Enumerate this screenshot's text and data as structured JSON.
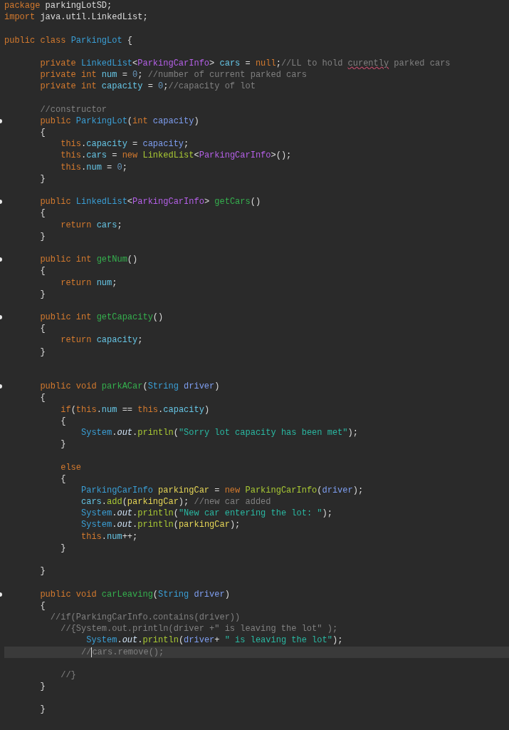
{
  "editor": {
    "lines": [
      {
        "kind": "code",
        "tokens": [
          {
            "kind": "keyword",
            "text": "package"
          },
          {
            "kind": "plain",
            "text": " parkingLotSD;"
          }
        ]
      },
      {
        "kind": "code",
        "tokens": [
          {
            "kind": "keyword",
            "text": "import"
          },
          {
            "kind": "plain",
            "text": " java.util.LinkedList;"
          }
        ]
      },
      {
        "kind": "blank"
      },
      {
        "kind": "code",
        "tokens": [
          {
            "kind": "keyword",
            "text": "public class "
          },
          {
            "kind": "type",
            "text": "ParkingLot"
          },
          {
            "kind": "plain",
            "text": " {"
          }
        ]
      },
      {
        "kind": "blank"
      },
      {
        "kind": "code",
        "tokens": [
          {
            "kind": "keyword",
            "text": "       private "
          },
          {
            "kind": "type",
            "text": "LinkedList"
          },
          {
            "kind": "plain",
            "text": "<"
          },
          {
            "kind": "generic",
            "text": "ParkingCarInfo"
          },
          {
            "kind": "plain",
            "text": "> "
          },
          {
            "kind": "field",
            "text": "cars"
          },
          {
            "kind": "plain",
            "text": " = "
          },
          {
            "kind": "keyword",
            "text": "null"
          },
          {
            "kind": "plain",
            "text": ";"
          },
          {
            "kind": "comment",
            "text": "//LL to hold "
          },
          {
            "kind": "misspelled",
            "text": "curently"
          },
          {
            "kind": "comment",
            "text": " parked cars"
          }
        ]
      },
      {
        "kind": "code",
        "tokens": [
          {
            "kind": "keyword",
            "text": "       private int "
          },
          {
            "kind": "field",
            "text": "num"
          },
          {
            "kind": "plain",
            "text": " = "
          },
          {
            "kind": "number",
            "text": "0"
          },
          {
            "kind": "plain",
            "text": ";"
          },
          {
            "kind": "comment",
            "text": " //number of current parked cars"
          }
        ]
      },
      {
        "kind": "code",
        "tokens": [
          {
            "kind": "keyword",
            "text": "       private int "
          },
          {
            "kind": "field",
            "text": "capacity"
          },
          {
            "kind": "plain",
            "text": " = "
          },
          {
            "kind": "number",
            "text": "0"
          },
          {
            "kind": "plain",
            "text": ";"
          },
          {
            "kind": "comment",
            "text": "//capacity of lot"
          }
        ]
      },
      {
        "kind": "blank"
      },
      {
        "kind": "code",
        "tokens": [
          {
            "kind": "comment",
            "text": "       //constructor"
          }
        ]
      },
      {
        "kind": "code",
        "marker": true,
        "tokens": [
          {
            "kind": "keyword",
            "text": "       public "
          },
          {
            "kind": "type",
            "text": "ParkingLot"
          },
          {
            "kind": "plain",
            "text": "("
          },
          {
            "kind": "keyword",
            "text": "int "
          },
          {
            "kind": "param",
            "text": "capacity"
          },
          {
            "kind": "plain",
            "text": ")"
          }
        ]
      },
      {
        "kind": "code",
        "tokens": [
          {
            "kind": "plain",
            "text": "       {"
          }
        ]
      },
      {
        "kind": "code",
        "tokens": [
          {
            "kind": "keyword",
            "text": "           this"
          },
          {
            "kind": "plain",
            "text": "."
          },
          {
            "kind": "field",
            "text": "capacity"
          },
          {
            "kind": "plain",
            "text": " = "
          },
          {
            "kind": "param",
            "text": "capacity"
          },
          {
            "kind": "plain",
            "text": ";"
          }
        ]
      },
      {
        "kind": "code",
        "tokens": [
          {
            "kind": "keyword",
            "text": "           this"
          },
          {
            "kind": "plain",
            "text": "."
          },
          {
            "kind": "field",
            "text": "cars"
          },
          {
            "kind": "plain",
            "text": " = "
          },
          {
            "kind": "keyword",
            "text": "new "
          },
          {
            "kind": "call",
            "text": "LinkedList"
          },
          {
            "kind": "plain",
            "text": "<"
          },
          {
            "kind": "generic",
            "text": "ParkingCarInfo"
          },
          {
            "kind": "plain",
            "text": ">();"
          }
        ]
      },
      {
        "kind": "code",
        "tokens": [
          {
            "kind": "keyword",
            "text": "           this"
          },
          {
            "kind": "plain",
            "text": "."
          },
          {
            "kind": "field",
            "text": "num"
          },
          {
            "kind": "plain",
            "text": " = "
          },
          {
            "kind": "number",
            "text": "0"
          },
          {
            "kind": "plain",
            "text": ";"
          }
        ]
      },
      {
        "kind": "code",
        "tokens": [
          {
            "kind": "plain",
            "text": "       }"
          }
        ]
      },
      {
        "kind": "blank"
      },
      {
        "kind": "code",
        "marker": true,
        "tokens": [
          {
            "kind": "keyword",
            "text": "       public "
          },
          {
            "kind": "type",
            "text": "LinkedList"
          },
          {
            "kind": "plain",
            "text": "<"
          },
          {
            "kind": "generic",
            "text": "ParkingCarInfo"
          },
          {
            "kind": "plain",
            "text": "> "
          },
          {
            "kind": "method",
            "text": "getCars"
          },
          {
            "kind": "plain",
            "text": "()"
          }
        ]
      },
      {
        "kind": "code",
        "tokens": [
          {
            "kind": "plain",
            "text": "       {"
          }
        ]
      },
      {
        "kind": "code",
        "tokens": [
          {
            "kind": "keyword",
            "text": "           return "
          },
          {
            "kind": "field",
            "text": "cars"
          },
          {
            "kind": "plain",
            "text": ";"
          }
        ]
      },
      {
        "kind": "code",
        "tokens": [
          {
            "kind": "plain",
            "text": "       }"
          }
        ]
      },
      {
        "kind": "blank"
      },
      {
        "kind": "code",
        "marker": true,
        "tokens": [
          {
            "kind": "keyword",
            "text": "       public int "
          },
          {
            "kind": "method",
            "text": "getNum"
          },
          {
            "kind": "plain",
            "text": "()"
          }
        ]
      },
      {
        "kind": "code",
        "tokens": [
          {
            "kind": "plain",
            "text": "       {"
          }
        ]
      },
      {
        "kind": "code",
        "tokens": [
          {
            "kind": "keyword",
            "text": "           return "
          },
          {
            "kind": "field",
            "text": "num"
          },
          {
            "kind": "plain",
            "text": ";"
          }
        ]
      },
      {
        "kind": "code",
        "tokens": [
          {
            "kind": "plain",
            "text": "       }"
          }
        ]
      },
      {
        "kind": "blank"
      },
      {
        "kind": "code",
        "marker": true,
        "tokens": [
          {
            "kind": "keyword",
            "text": "       public int "
          },
          {
            "kind": "method",
            "text": "getCapacity"
          },
          {
            "kind": "plain",
            "text": "()"
          }
        ]
      },
      {
        "kind": "code",
        "tokens": [
          {
            "kind": "plain",
            "text": "       {"
          }
        ]
      },
      {
        "kind": "code",
        "tokens": [
          {
            "kind": "keyword",
            "text": "           return "
          },
          {
            "kind": "field",
            "text": "capacity"
          },
          {
            "kind": "plain",
            "text": ";"
          }
        ]
      },
      {
        "kind": "code",
        "tokens": [
          {
            "kind": "plain",
            "text": "       }"
          }
        ]
      },
      {
        "kind": "blank"
      },
      {
        "kind": "blank"
      },
      {
        "kind": "code",
        "marker": true,
        "tokens": [
          {
            "kind": "keyword",
            "text": "       public void "
          },
          {
            "kind": "method",
            "text": "parkACar"
          },
          {
            "kind": "plain",
            "text": "("
          },
          {
            "kind": "type",
            "text": "String "
          },
          {
            "kind": "param",
            "text": "driver"
          },
          {
            "kind": "plain",
            "text": ")"
          }
        ]
      },
      {
        "kind": "code",
        "tokens": [
          {
            "kind": "plain",
            "text": "       {"
          }
        ]
      },
      {
        "kind": "code",
        "tokens": [
          {
            "kind": "keyword",
            "text": "           if"
          },
          {
            "kind": "plain",
            "text": "("
          },
          {
            "kind": "keyword",
            "text": "this"
          },
          {
            "kind": "plain",
            "text": "."
          },
          {
            "kind": "field",
            "text": "num"
          },
          {
            "kind": "plain",
            "text": " == "
          },
          {
            "kind": "keyword",
            "text": "this"
          },
          {
            "kind": "plain",
            "text": "."
          },
          {
            "kind": "field",
            "text": "capacity"
          },
          {
            "kind": "plain",
            "text": ")"
          }
        ]
      },
      {
        "kind": "code",
        "tokens": [
          {
            "kind": "plain",
            "text": "           {"
          }
        ]
      },
      {
        "kind": "code",
        "tokens": [
          {
            "kind": "type",
            "text": "               System"
          },
          {
            "kind": "plain",
            "text": "."
          },
          {
            "kind": "static",
            "text": "out"
          },
          {
            "kind": "plain",
            "text": "."
          },
          {
            "kind": "call",
            "text": "println"
          },
          {
            "kind": "plain",
            "text": "("
          },
          {
            "kind": "string",
            "text": "\"Sorry lot capacity has been met\""
          },
          {
            "kind": "plain",
            "text": ");"
          }
        ]
      },
      {
        "kind": "code",
        "tokens": [
          {
            "kind": "plain",
            "text": "           }"
          }
        ]
      },
      {
        "kind": "blank"
      },
      {
        "kind": "code",
        "tokens": [
          {
            "kind": "keyword",
            "text": "           else"
          }
        ]
      },
      {
        "kind": "code",
        "tokens": [
          {
            "kind": "plain",
            "text": "           {"
          }
        ]
      },
      {
        "kind": "code",
        "tokens": [
          {
            "kind": "type",
            "text": "               ParkingCarInfo "
          },
          {
            "kind": "local",
            "text": "parkingCar"
          },
          {
            "kind": "plain",
            "text": " = "
          },
          {
            "kind": "keyword",
            "text": "new "
          },
          {
            "kind": "call",
            "text": "ParkingCarInfo"
          },
          {
            "kind": "plain",
            "text": "("
          },
          {
            "kind": "param",
            "text": "driver"
          },
          {
            "kind": "plain",
            "text": ");"
          }
        ]
      },
      {
        "kind": "code",
        "tokens": [
          {
            "kind": "field",
            "text": "               cars"
          },
          {
            "kind": "plain",
            "text": "."
          },
          {
            "kind": "call",
            "text": "add"
          },
          {
            "kind": "plain",
            "text": "("
          },
          {
            "kind": "local",
            "text": "parkingCar"
          },
          {
            "kind": "plain",
            "text": ");"
          },
          {
            "kind": "comment",
            "text": " //new car added"
          }
        ]
      },
      {
        "kind": "code",
        "tokens": [
          {
            "kind": "type",
            "text": "               System"
          },
          {
            "kind": "plain",
            "text": "."
          },
          {
            "kind": "static",
            "text": "out"
          },
          {
            "kind": "plain",
            "text": "."
          },
          {
            "kind": "call",
            "text": "println"
          },
          {
            "kind": "plain",
            "text": "("
          },
          {
            "kind": "string",
            "text": "\"New car entering the lot: \""
          },
          {
            "kind": "plain",
            "text": ");"
          }
        ]
      },
      {
        "kind": "code",
        "tokens": [
          {
            "kind": "type",
            "text": "               System"
          },
          {
            "kind": "plain",
            "text": "."
          },
          {
            "kind": "static",
            "text": "out"
          },
          {
            "kind": "plain",
            "text": "."
          },
          {
            "kind": "call",
            "text": "println"
          },
          {
            "kind": "plain",
            "text": "("
          },
          {
            "kind": "local",
            "text": "parkingCar"
          },
          {
            "kind": "plain",
            "text": ");"
          }
        ]
      },
      {
        "kind": "code",
        "tokens": [
          {
            "kind": "keyword",
            "text": "               this"
          },
          {
            "kind": "plain",
            "text": "."
          },
          {
            "kind": "field",
            "text": "num"
          },
          {
            "kind": "plain",
            "text": "++;"
          }
        ]
      },
      {
        "kind": "code",
        "tokens": [
          {
            "kind": "plain",
            "text": "           }"
          }
        ]
      },
      {
        "kind": "blank"
      },
      {
        "kind": "code",
        "tokens": [
          {
            "kind": "plain",
            "text": "       }"
          }
        ]
      },
      {
        "kind": "blank"
      },
      {
        "kind": "code",
        "marker": true,
        "tokens": [
          {
            "kind": "keyword",
            "text": "       public void "
          },
          {
            "kind": "method",
            "text": "carLeaving"
          },
          {
            "kind": "plain",
            "text": "("
          },
          {
            "kind": "type",
            "text": "String "
          },
          {
            "kind": "param",
            "text": "driver"
          },
          {
            "kind": "plain",
            "text": ")"
          }
        ]
      },
      {
        "kind": "code",
        "tokens": [
          {
            "kind": "plain",
            "text": "       {"
          }
        ]
      },
      {
        "kind": "code",
        "tokens": [
          {
            "kind": "comment",
            "text": "         //if(ParkingCarInfo.contains(driver))"
          }
        ]
      },
      {
        "kind": "code",
        "tokens": [
          {
            "kind": "comment",
            "text": "           //{System.out.println(driver +\" is leaving the lot\" );"
          }
        ]
      },
      {
        "kind": "code",
        "tokens": [
          {
            "kind": "type",
            "text": "                System"
          },
          {
            "kind": "plain",
            "text": "."
          },
          {
            "kind": "static",
            "text": "out"
          },
          {
            "kind": "plain",
            "text": "."
          },
          {
            "kind": "call",
            "text": "println"
          },
          {
            "kind": "plain",
            "text": "("
          },
          {
            "kind": "param",
            "text": "driver"
          },
          {
            "kind": "plain",
            "text": "+ "
          },
          {
            "kind": "string",
            "text": "\" is leaving the lot\""
          },
          {
            "kind": "plain",
            "text": ");"
          }
        ]
      },
      {
        "kind": "code",
        "current": true,
        "tokens": [
          {
            "kind": "comment",
            "text": "               //"
          },
          {
            "kind": "comment",
            "caret": true,
            "text": "cars.remove();"
          }
        ]
      },
      {
        "kind": "blank"
      },
      {
        "kind": "code",
        "tokens": [
          {
            "kind": "comment",
            "text": "           //}"
          }
        ]
      },
      {
        "kind": "code",
        "tokens": [
          {
            "kind": "plain",
            "text": "       }"
          }
        ]
      },
      {
        "kind": "blank"
      },
      {
        "kind": "code",
        "tokens": [
          {
            "kind": "plain",
            "text": "       }"
          }
        ]
      }
    ]
  }
}
